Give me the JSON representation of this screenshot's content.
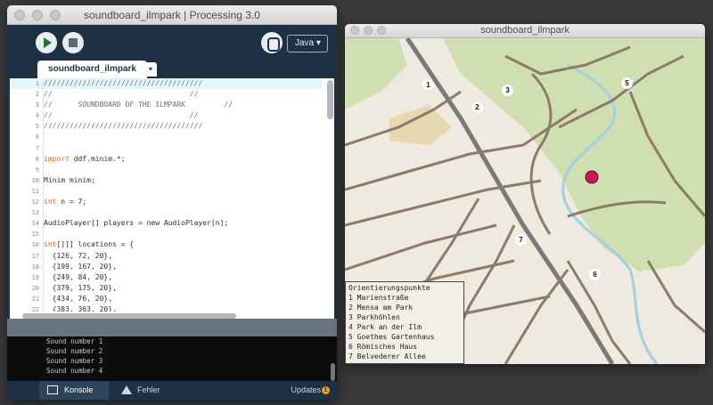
{
  "ide": {
    "window_title": "soundboard_ilmpark | Processing 3.0",
    "mode": "Java ▾",
    "tab_name": "soundboard_ilmpark",
    "tab_menu": "▾",
    "code_lines": [
      "/////////////////////////////////////",
      "//                                //",
      "//      SOUNDBOARD OF THE ILMPARK         //",
      "//                                //",
      "/////////////////////////////////////",
      "",
      "",
      "import ddf.minim.*;",
      "",
      "Minim minim;",
      "",
      "int n = 7;",
      "",
      "AudioPlayer[] players = new AudioPlayer[n];",
      "",
      "int[][] locations = {",
      "  {126, 72, 20},",
      "  {199, 167, 20},",
      "  {249, 84, 20},",
      "  {379, 175, 20},",
      "  {434, 76, 20},",
      "  {383, 363, 20},"
    ],
    "line_numbers": [
      "1",
      "2",
      "3",
      "4",
      "5",
      "6",
      "7",
      "8",
      "9",
      "10",
      "11",
      "12",
      "13",
      "14",
      "15",
      "16",
      "17",
      "18",
      "19",
      "20",
      "21",
      "22"
    ],
    "console_lines": [
      "Sound number 1",
      "Sound number 2",
      "Sound number 3",
      "Sound number 4"
    ],
    "footer": {
      "console_label": "Konsole",
      "errors_label": "Fehler",
      "updates_label": "Updates",
      "updates_count": "1"
    }
  },
  "sketch": {
    "window_title": "soundboard_ilmpark",
    "legend_title": "Orientierungspunkte",
    "legend_items": [
      "1 Marienstraße",
      "2 Mensa am Park",
      "3 Parkhöhlen",
      "4 Park an der Ilm",
      "5 Goethes Gartenhaus",
      "6 Römisches Haus",
      "7 Belvederer Allee"
    ],
    "markers": [
      "1",
      "2",
      "3",
      "5",
      "6",
      "7"
    ],
    "colors": {
      "park": "#cfdfb0",
      "road": "#8c7b69",
      "water": "#a4cfe0",
      "rail": "#7a7a7a",
      "pointer": "#d1135a"
    }
  }
}
